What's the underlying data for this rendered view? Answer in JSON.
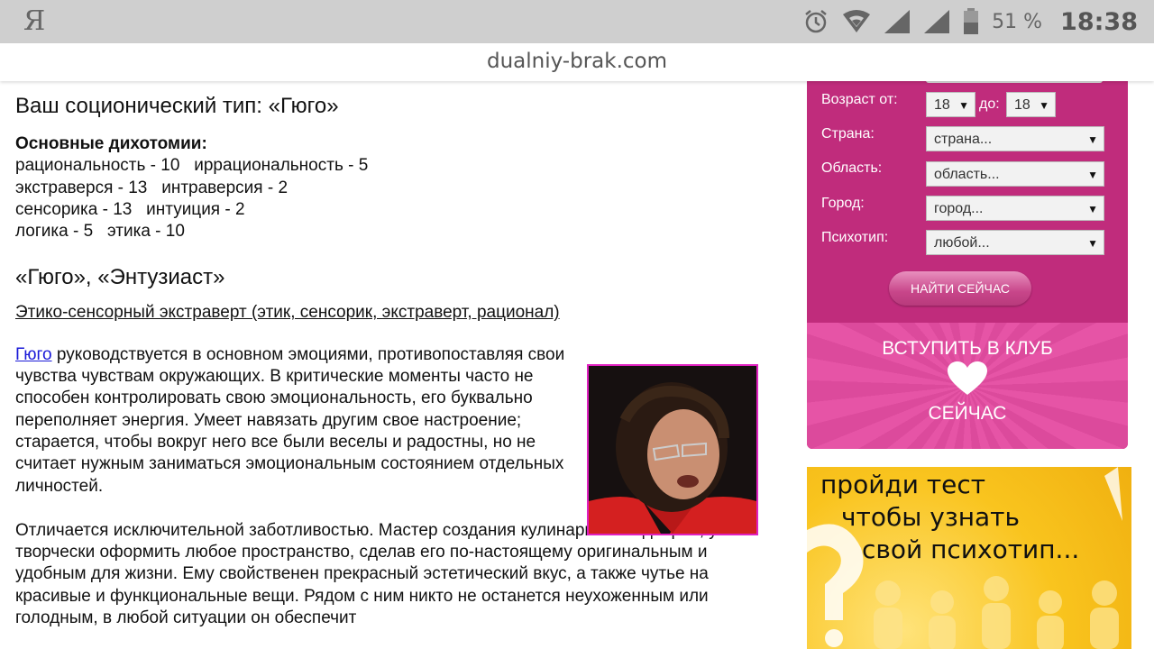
{
  "status_bar": {
    "logo": "Я",
    "battery_percent": "51 %",
    "time": "18:38"
  },
  "url_bar": {
    "domain": "dualniy-brak.com"
  },
  "article": {
    "title": "Ваш соционический тип: «Гюго»",
    "dichotomies_heading": "Основные дихотомии:",
    "dichotomies": [
      "рациональность - 10   иррациональность - 5",
      "экстраверся - 13   интраверсия - 2",
      "сенсорика - 13   интуиция - 2",
      "логика - 5   этика - 10"
    ],
    "type_names": "«Гюго», «Энтузиаст»",
    "type_description": "Этико-сенсорный экстраверт (этик, сенсорик, экстраверт, рационал)",
    "para1_link": "Гюго",
    "para1_text": " руководствуется в основном эмоциями, противопоставляя свои чувства чувствам окружающих. В критические моменты часто не способен контролировать свою эмоциональность, его буквально переполняет энергия. Умеет навязать другим свое настроение; старается, чтобы вокруг него все были веселы и радостны, но не считает нужным заниматься эмоциональным состоянием отдельных личностей.",
    "para2_text": "Отличается исключительной заботливостью. Мастер создания кулинарных шедевров, умеет творчески оформить любое пространство, сделав его по-настоящему оригинальным и удобным для жизни. Ему свойственен прекрасный эстетический вкус, а также чутье на красивые и функциональные вещи. Рядом с ним никто не останется неухоженным или голодным, в любой ситуации он обеспечит"
  },
  "search_form": {
    "age_from_label": "Возраст от:",
    "age_from_value": "18",
    "age_to_label": "до:",
    "age_to_value": "18",
    "country_label": "Страна:",
    "country_value": "страна...",
    "region_label": "Область:",
    "region_value": "область...",
    "city_label": "Город:",
    "city_value": "город...",
    "psychotype_label": "Психотип:",
    "psychotype_value": "любой...",
    "find_button": "НАЙТИ СЕЙЧАС",
    "select_arrow": "▼"
  },
  "join_banner": {
    "line1": "ВСТУПИТЬ В КЛУБ",
    "line2": "СЕЙЧАС"
  },
  "test_banner": {
    "line1": "пройди тест",
    "line2": "чтобы узнать",
    "line3": "свой психотип..."
  },
  "colors": {
    "form_bg": "#c02c7c",
    "banner_yellow": "#f9c41e",
    "link": "#1a1ad8",
    "photo_border": "#e020c0"
  }
}
